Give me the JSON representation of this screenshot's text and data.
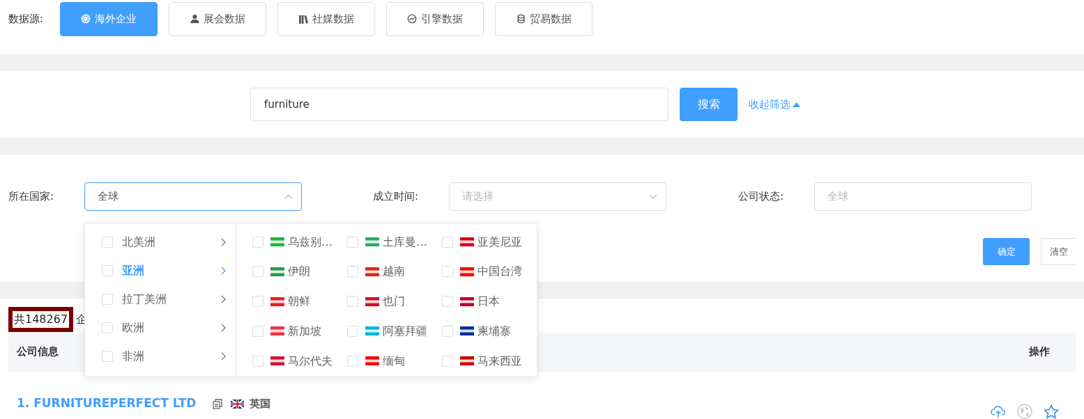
{
  "source_bar": {
    "label": "数据源:",
    "tabs": [
      {
        "label": "海外企业",
        "selected": true
      },
      {
        "label": "展会数据",
        "selected": false
      },
      {
        "label": "社媒数据",
        "selected": false
      },
      {
        "label": "引擎数据",
        "selected": false
      },
      {
        "label": "贸易数据",
        "selected": false
      }
    ]
  },
  "search": {
    "value": "furniture",
    "button": "搜索",
    "toggle": "收起筛选"
  },
  "filters": [
    {
      "label": "所在国家:",
      "value": "全球",
      "expanded": true
    },
    {
      "label": "成立时间:",
      "placeholder": "请选择",
      "expanded": false
    },
    {
      "label": "公司状态:",
      "placeholder": "全球"
    }
  ],
  "filter_buttons": [
    "确定",
    "清空"
  ],
  "country_menu": {
    "regions": [
      {
        "label": "北美洲",
        "selected": false,
        "checked": false
      },
      {
        "label": "亚洲",
        "selected": true,
        "checked": false
      },
      {
        "label": "拉丁美洲",
        "selected": false,
        "checked": false
      },
      {
        "label": "欧洲",
        "selected": false,
        "checked": false
      },
      {
        "label": "非洲",
        "selected": false,
        "checked": false
      }
    ],
    "countries": [
      {
        "label": "乌兹别…",
        "checked": false,
        "color": "#1eb53a"
      },
      {
        "label": "土库曼…",
        "checked": false,
        "color": "#28ae66"
      },
      {
        "label": "亚美尼亚",
        "checked": false,
        "color": "#d90012"
      },
      {
        "label": "伊朗",
        "checked": false,
        "color": "#239f40"
      },
      {
        "label": "越南",
        "checked": false,
        "color": "#da251d"
      },
      {
        "label": "中国台湾",
        "checked": false,
        "color": "#fe0000"
      },
      {
        "label": "朝鲜",
        "checked": false,
        "color": "#ed1c27"
      },
      {
        "label": "也门",
        "checked": false,
        "color": "#ce1126"
      },
      {
        "label": "日本",
        "checked": false,
        "color": "#bc002d"
      },
      {
        "label": "新加坡",
        "checked": false,
        "color": "#ef3340"
      },
      {
        "label": "阿塞拜疆",
        "checked": false,
        "color": "#00b5e2"
      },
      {
        "label": "柬埔寨",
        "checked": false,
        "color": "#032ea1"
      },
      {
        "label": "马尔代夫",
        "checked": false,
        "color": "#d21034"
      },
      {
        "label": "缅甸",
        "checked": false,
        "color": "#fe0000"
      },
      {
        "label": "马来西亚",
        "checked": false,
        "color": "#cc0001"
      }
    ]
  },
  "results": {
    "count": "共148267",
    "count_suffix": "企",
    "columns": [
      "公司信息",
      "操作"
    ],
    "rows": [
      {
        "name": "1. FURNITUREPERFECT LTD",
        "country": "英国"
      }
    ]
  }
}
